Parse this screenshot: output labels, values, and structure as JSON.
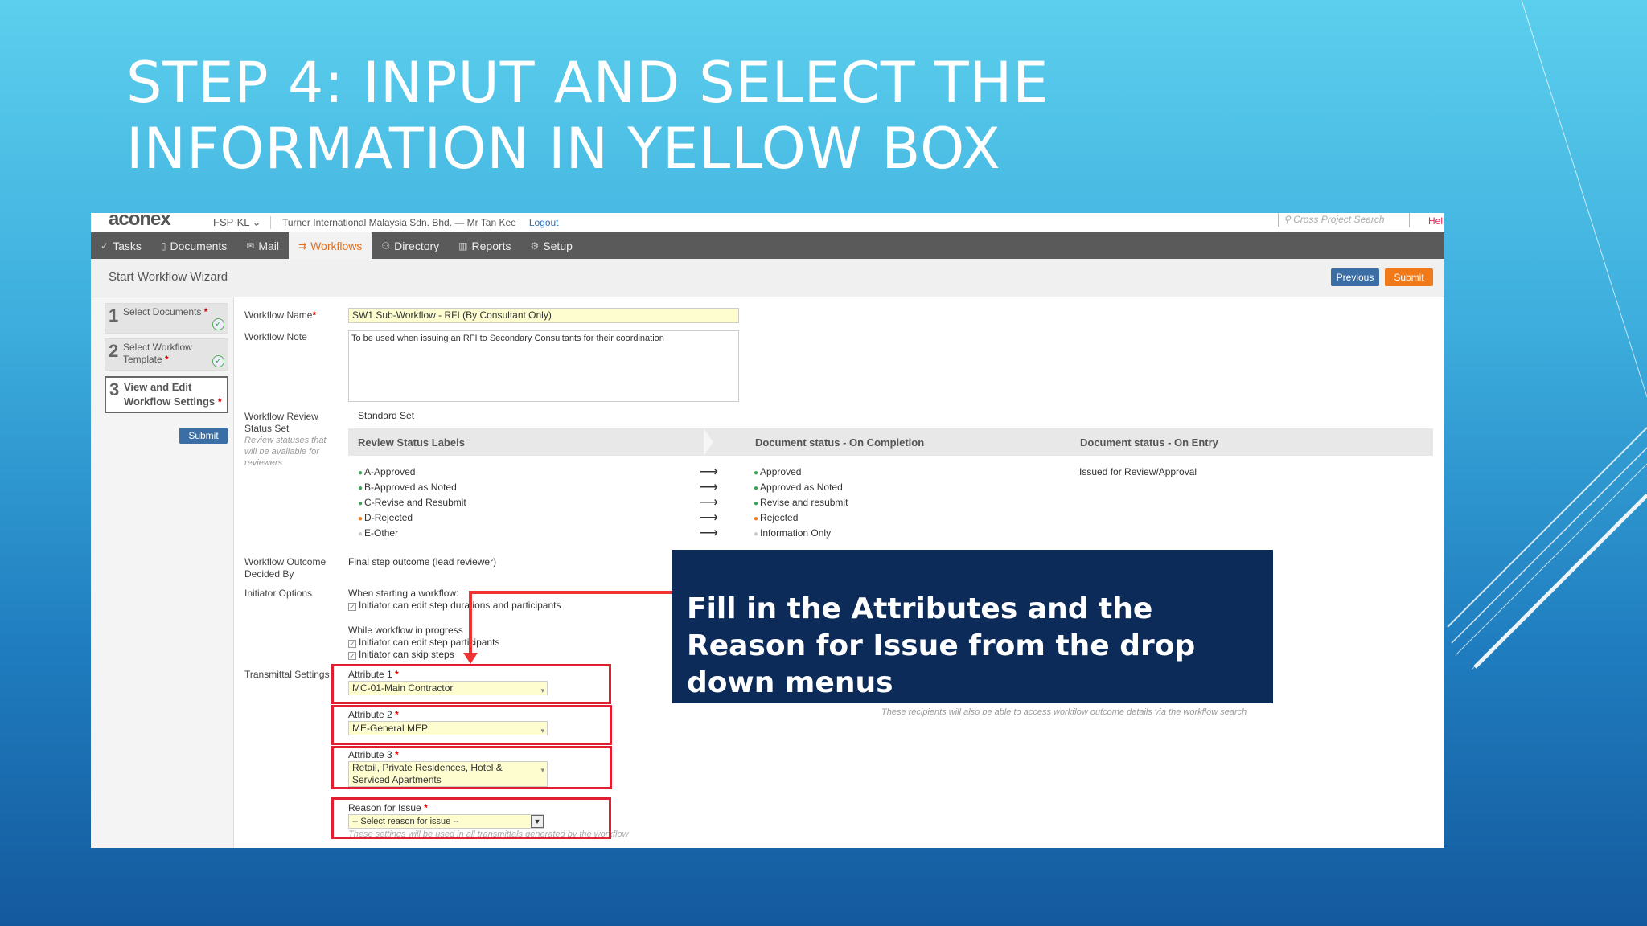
{
  "slide": {
    "title": "STEP 4: INPUT AND SELECT THE INFORMATION IN YELLOW BOX",
    "callout": "Fill in the Attributes and the Reason for Issue from the drop down menus"
  },
  "app": {
    "logo": "aconex",
    "project": "FSP-KL",
    "organization": "Turner International Malaysia Sdn. Bhd.  —  Mr Tan Kee",
    "logout": "Logout",
    "search_placeholder": "Cross Project Search",
    "help": "Hel"
  },
  "nav": [
    {
      "label": "Tasks",
      "icon": "check-icon"
    },
    {
      "label": "Documents",
      "icon": "document-icon"
    },
    {
      "label": "Mail",
      "icon": "mail-icon"
    },
    {
      "label": "Workflows",
      "icon": "workflow-icon",
      "active": true
    },
    {
      "label": "Directory",
      "icon": "people-icon"
    },
    {
      "label": "Reports",
      "icon": "chart-icon"
    },
    {
      "label": "Setup",
      "icon": "gear-icon"
    }
  ],
  "wizard": {
    "title": "Start Workflow Wizard",
    "previous": "Previous",
    "submit": "Submit",
    "steps": [
      {
        "num": "1",
        "label": "Select Documents",
        "done": true
      },
      {
        "num": "2",
        "label": "Select Workflow Template",
        "done": true
      },
      {
        "num": "3",
        "label": "View and Edit Workflow Settings",
        "current": true
      }
    ],
    "left_submit": "Submit"
  },
  "form": {
    "workflow_name_label": "Workflow Name",
    "workflow_name": "SW1 Sub-Workflow - RFI (By Consultant Only)",
    "workflow_note_label": "Workflow Note",
    "workflow_note": "To be used when issuing an RFI to Secondary Consultants for their coordination",
    "review_status_label": "Workflow Review Status Set",
    "review_status_sub": "Review statuses that will be available for reviewers",
    "review_status_value": "Standard Set",
    "col_labels": "Review Status Labels",
    "col_completion": "Document status - On Completion",
    "col_entry": "Document status - On Entry",
    "entry_status": "Issued for Review/Approval",
    "statuses": [
      {
        "label": "A-Approved",
        "color": "#3aa655",
        "doc": "Approved",
        "doc_color": "#3aa655"
      },
      {
        "label": "B-Approved as Noted",
        "color": "#3aa655",
        "doc": "Approved as Noted",
        "doc_color": "#3aa655"
      },
      {
        "label": "C-Revise and Resubmit",
        "color": "#3aa655",
        "doc": "Revise and resubmit",
        "doc_color": "#3aa655"
      },
      {
        "label": "D-Rejected",
        "color": "#f07a1a",
        "doc": "Rejected",
        "doc_color": "#f07a1a"
      },
      {
        "label": "E-Other",
        "color": "#cccccc",
        "doc": "Information Only",
        "doc_color": "#cccccc"
      }
    ],
    "arrow_glyph": "⟶",
    "outcome_label": "Workflow Outcome Decided By",
    "outcome_value": "Final step outcome (lead reviewer)",
    "initiator_label": "Initiator Options",
    "when_starting": "When starting a workflow:",
    "opt1": "Initiator can edit step durations and participants",
    "while_progress": "While workflow in progress",
    "opt2": "Initiator can edit step participants",
    "opt3": "Initiator can skip steps",
    "transmittal_label": "Transmittal Settings",
    "attr1_label": "Attribute 1",
    "attr1_value": "MC-01-Main Contractor",
    "attr2_label": "Attribute 2",
    "attr2_value": "ME-General MEP",
    "attr3_label": "Attribute 3",
    "attr3_value_line1": "Retail, Private Residences, Hotel &",
    "attr3_value_line2": "Serviced Apartments",
    "reason_label": "Reason for Issue",
    "reason_value": "-- Select reason for issue --",
    "recipients_note": "These recipients will also be able to access workflow outcome details via the workflow search",
    "footnote": "These settings will be used in all transmittals generated by the workflow"
  },
  "colors": {
    "accent": "#f07a1a",
    "primary_button": "#3a6ea5",
    "highlight": "#e02030",
    "callout_bg": "#0d2b58"
  }
}
